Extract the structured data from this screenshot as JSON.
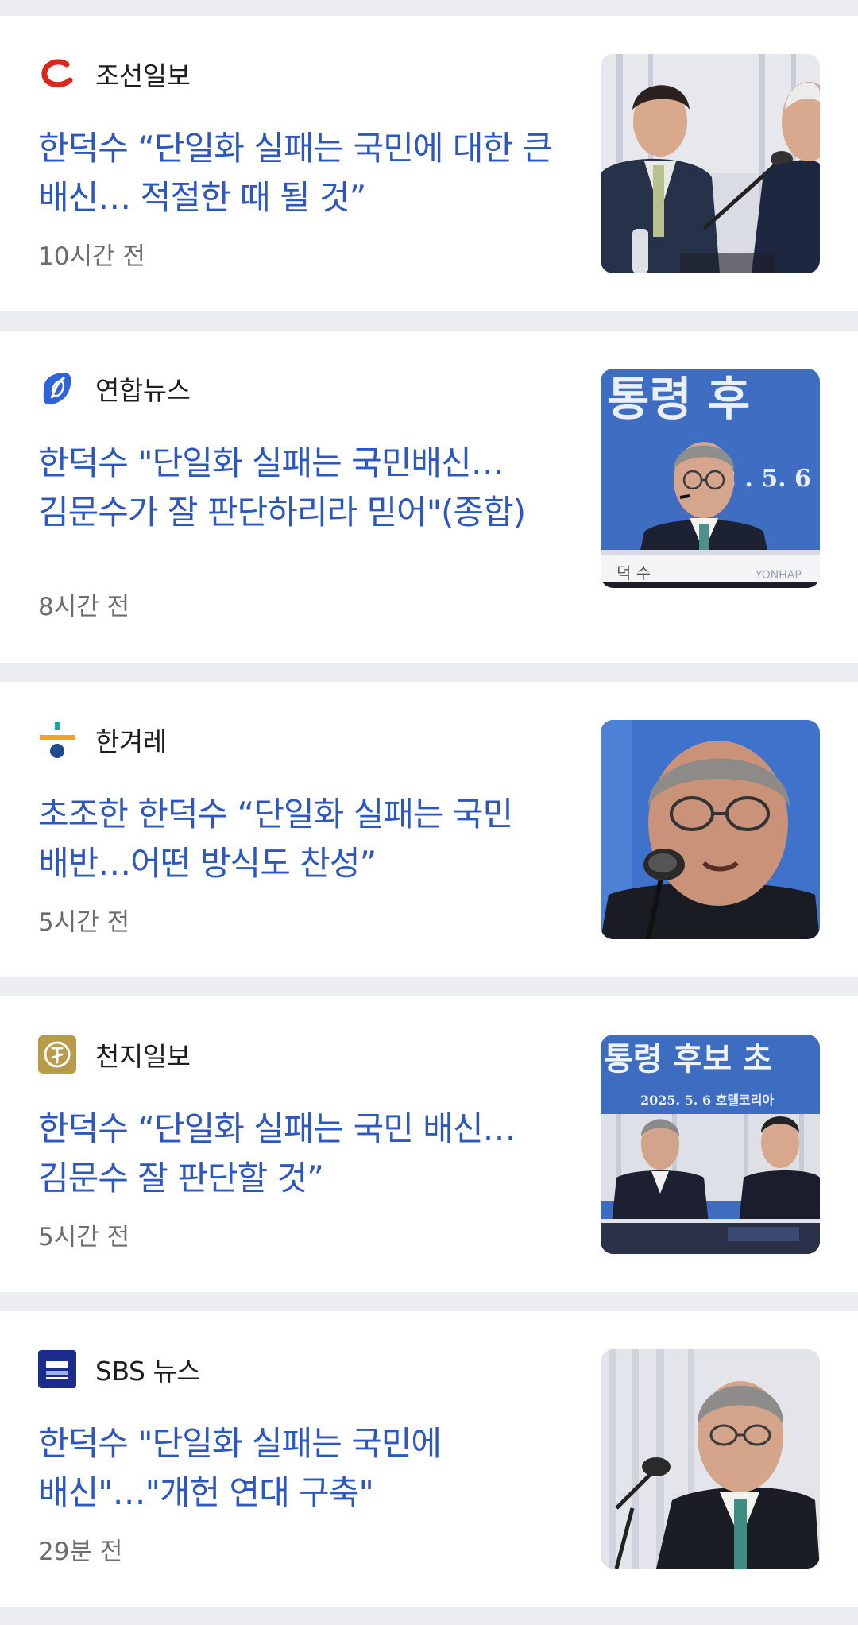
{
  "articles": [
    {
      "source": "조선일보",
      "logo_icon": "chosun-logo-icon",
      "headline": "한덕수 “단일화 실패는 국민에 대한 큰 배신… 적절한 때 될 것”",
      "time": "10시간 전"
    },
    {
      "source": "연합뉴스",
      "logo_icon": "yonhap-logo-icon",
      "headline": "한덕수 \"단일화 실패는 국민배신… 김문수가 잘 판단하리라 믿어\"(종합)",
      "time": "8시간 전",
      "thumbnail_text": {
        "banner": "통령 후",
        "date": "2 . 5. 6",
        "nameplate": "덕 수",
        "logo": "YONHAP"
      }
    },
    {
      "source": "한겨레",
      "logo_icon": "hankyoreh-logo-icon",
      "headline": "초조한 한덕수 “단일화 실패는 국민 배반…어떤 방식도 찬성”",
      "time": "5시간 전"
    },
    {
      "source": "천지일보",
      "logo_icon": "cheonji-logo-icon",
      "headline": "한덕수 “단일화 실패는 국민 배신… 김문수 잘 판단할 것”",
      "time": "5시간 전",
      "thumbnail_text": {
        "banner": "통령 후보 초",
        "date": "2025. 5. 6   호텔코리아"
      }
    },
    {
      "source": "SBS 뉴스",
      "logo_icon": "sbs-news-logo-icon",
      "headline": "한덕수 \"단일화 실패는 국민에 배신\"…\"개헌 연대 구축\"",
      "time": "29분 전"
    }
  ],
  "colors": {
    "headline": "#2C57C3",
    "source": "#1E1E1E",
    "time": "#6D6D6D",
    "divider": "#ECEDF0",
    "card": "#FFFFFF"
  }
}
